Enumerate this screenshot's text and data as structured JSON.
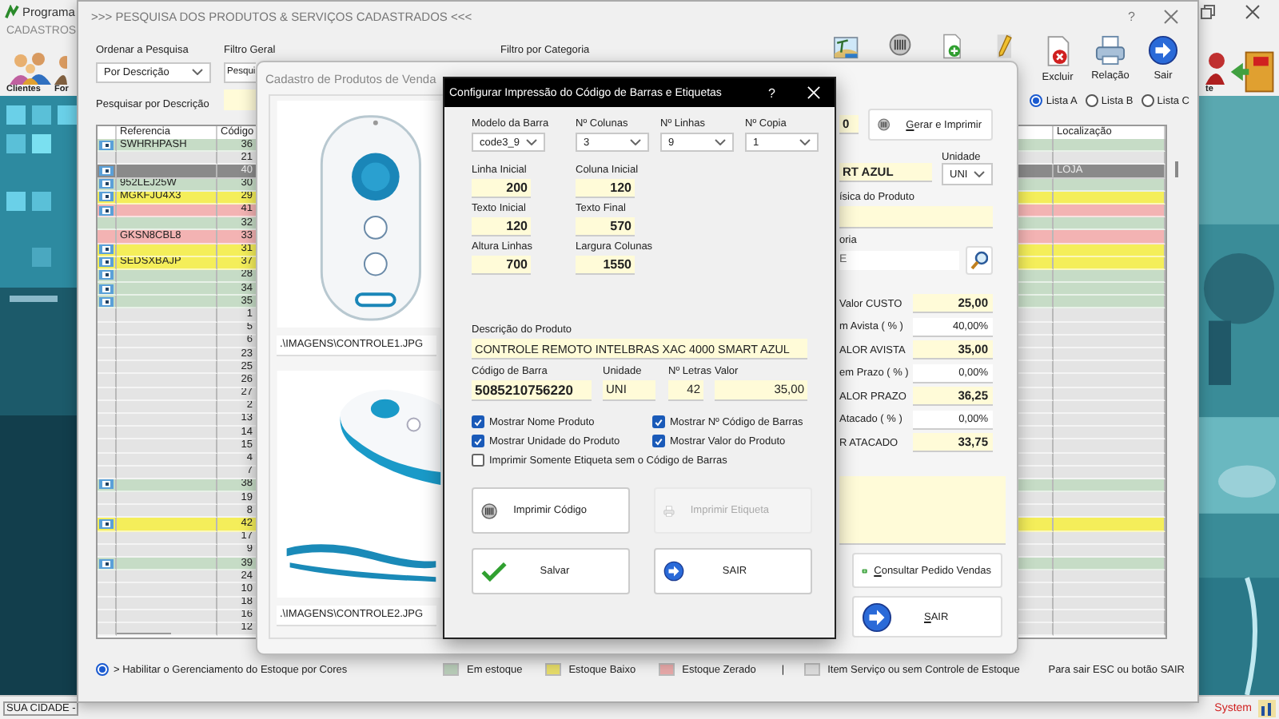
{
  "app": {
    "title": "Programa",
    "menu": [
      "CADASTROS"
    ],
    "toolbar": [
      {
        "kind": "people",
        "label": "Clientes"
      },
      {
        "kind": "person",
        "label": "For"
      }
    ],
    "right_toolbar": [
      {
        "kind": "person",
        "label": "te"
      },
      {
        "kind": "exit"
      }
    ],
    "status_bar": {
      "left": "SUA CIDADE -",
      "right": "System"
    }
  },
  "search_window": {
    "title": ">>> PESQUISA DOS PRODUTOS & SERVIÇOS CADASTRADOS <<<",
    "help": "?",
    "sort": {
      "label": "Ordenar a Pesquisa",
      "value": "Por Descrição"
    },
    "general_filter": {
      "label": "Filtro Geral",
      "value": "Pesqui"
    },
    "category_filter": {
      "label": "Filtro por Categoria"
    },
    "search": {
      "label": "Pesquisar por Descrição"
    },
    "toolbar": [
      {
        "kind": "picture"
      },
      {
        "kind": "barcode"
      },
      {
        "kind": "add"
      },
      {
        "kind": "edit"
      },
      {
        "kind": "delete",
        "label": "Excluir"
      },
      {
        "kind": "report",
        "label": "Relação"
      },
      {
        "kind": "exit",
        "label": "Sair"
      }
    ],
    "lists": [
      {
        "label": "Lista A",
        "selected": true
      },
      {
        "label": "Lista B",
        "selected": false
      },
      {
        "label": "Lista C",
        "selected": false
      }
    ],
    "table": {
      "columns": [
        "Referencia",
        "Código",
        "Localização"
      ],
      "rows": [
        {
          "reference": "SWHRHPASH",
          "code": "36",
          "color": "#c6dcc6",
          "icon": true,
          "selected": false
        },
        {
          "code": "21",
          "color": "#e4e4e4",
          "icon": false,
          "selected": false
        },
        {
          "code": "40",
          "icon": true,
          "selected": true,
          "location": "LOJA"
        },
        {
          "reference": "952LEJ25W",
          "code": "30",
          "color": "#c6dcc6",
          "icon": true,
          "selected": false
        },
        {
          "reference": "MGKFJU4X3",
          "code": "29",
          "color": "#f4ee5a",
          "icon": true,
          "selected": false
        },
        {
          "code": "41",
          "color": "#f3b3b3",
          "icon": true,
          "selected": false
        },
        {
          "code": "32",
          "color": "#c6dcc6",
          "icon": false,
          "selected": false
        },
        {
          "reference": "GKSN8CBL8",
          "code": "33",
          "color": "#f3b3b3",
          "icon": false,
          "selected": false
        },
        {
          "code": "31",
          "color": "#f4ee5a",
          "icon": true,
          "selected": false
        },
        {
          "reference": "SEDSXBAJP",
          "code": "37",
          "color": "#f4ee5a",
          "icon": true,
          "selected": false
        },
        {
          "code": "28",
          "color": "#c6dcc6",
          "icon": true,
          "selected": false
        },
        {
          "code": "34",
          "color": "#c6dcc6",
          "icon": true,
          "selected": false
        },
        {
          "code": "35",
          "color": "#c6dcc6",
          "icon": true,
          "selected": false
        },
        {
          "code": "1",
          "color": "#e4e4e4",
          "icon": false,
          "selected": false
        },
        {
          "code": "5",
          "color": "#e4e4e4",
          "icon": false,
          "selected": false
        },
        {
          "code": "6",
          "color": "#e4e4e4",
          "icon": false,
          "selected": false
        },
        {
          "code": "23",
          "color": "#e4e4e4",
          "icon": false,
          "selected": false
        },
        {
          "code": "25",
          "color": "#e4e4e4",
          "icon": false,
          "selected": false
        },
        {
          "code": "26",
          "color": "#e4e4e4",
          "icon": false,
          "selected": false
        },
        {
          "code": "27",
          "color": "#e4e4e4",
          "icon": false,
          "selected": false
        },
        {
          "code": "2",
          "color": "#e4e4e4",
          "icon": false,
          "selected": false
        },
        {
          "code": "13",
          "color": "#e4e4e4",
          "icon": false,
          "selected": false
        },
        {
          "code": "14",
          "color": "#e4e4e4",
          "icon": false,
          "selected": false
        },
        {
          "code": "15",
          "color": "#e4e4e4",
          "icon": false,
          "selected": false
        },
        {
          "code": "4",
          "color": "#e4e4e4",
          "icon": false,
          "selected": false
        },
        {
          "code": "7",
          "color": "#e4e4e4",
          "icon": false,
          "selected": false
        },
        {
          "code": "38",
          "color": "#c6dcc6",
          "icon": true,
          "selected": false
        },
        {
          "code": "19",
          "color": "#e4e4e4",
          "icon": false,
          "selected": false
        },
        {
          "code": "8",
          "color": "#e4e4e4",
          "icon": false,
          "selected": false
        },
        {
          "code": "42",
          "color": "#f4ee5a",
          "icon": true,
          "selected": false
        },
        {
          "code": "17",
          "color": "#e4e4e4",
          "icon": false,
          "selected": false
        },
        {
          "code": "9",
          "color": "#e4e4e4",
          "icon": false,
          "selected": false
        },
        {
          "code": "39",
          "color": "#c6dcc6",
          "icon": true,
          "selected": false
        },
        {
          "code": "24",
          "color": "#e4e4e4",
          "icon": false,
          "selected": false
        },
        {
          "code": "10",
          "color": "#e4e4e4",
          "icon": false,
          "selected": false
        },
        {
          "code": "18",
          "color": "#e4e4e4",
          "icon": false,
          "selected": false
        },
        {
          "code": "16",
          "color": "#e4e4e4",
          "icon": false,
          "selected": false
        },
        {
          "code": "12",
          "color": "#e4e4e4",
          "icon": false,
          "selected": false
        }
      ]
    },
    "legend": {
      "toggle": {
        "label": "> Habilitar o Gerenciamento do Estoque por Cores",
        "on": true
      },
      "items": [
        {
          "label": "Em estoque",
          "color": "#b8ccb8"
        },
        {
          "label": "Estoque Baixo",
          "color": "#e6dc6a"
        },
        {
          "label": "Estoque Zerado",
          "color": "#e6a8a8"
        },
        {
          "label": "Item Serviço ou sem Controle de Estoque",
          "color": "#dcdcdc"
        }
      ],
      "separator": "|",
      "exit_hint": "Para sair ESC ou botão SAIR"
    }
  },
  "product_window": {
    "title": "Cadastro de Produtos de Venda",
    "images": [
      {
        "path": ".\\IMAGENS\\CONTROLE1.JPG"
      },
      {
        "path": ".\\IMAGENS\\CONTROLE2.JPG"
      }
    ],
    "code_value": "0",
    "generate_button": "Gerar e Imprimir",
    "description_value": "RT AZUL",
    "unit": {
      "label": "Unidade",
      "value": "UNI"
    },
    "physical_label": "ísica do Produto",
    "category_label": "oria",
    "category_value": "E",
    "prices": [
      {
        "label": "Valor CUSTO",
        "value": "25,00",
        "kind": "total"
      },
      {
        "label": "m Avista ( % )",
        "value": "40,00%",
        "kind": "percent"
      },
      {
        "label": "ALOR AVISTA",
        "value": "35,00",
        "kind": "total"
      },
      {
        "label": "em Prazo ( % )",
        "value": "0,00%",
        "kind": "percent"
      },
      {
        "label": "ALOR PRAZO",
        "value": "36,25",
        "kind": "total"
      },
      {
        "label": "Atacado ( % )",
        "value": "0,00%",
        "kind": "percent"
      },
      {
        "label": "R ATACADO",
        "value": "33,75",
        "kind": "total"
      }
    ],
    "buttons": [
      {
        "kind": "orders",
        "label": "Consultar Pedido Vendas"
      },
      {
        "kind": "exit",
        "label": "SAIR"
      }
    ]
  },
  "dialog": {
    "title": "Configurar Impressão do Código de Barras e Etiquetas",
    "help": "?",
    "selects": [
      {
        "label": "Modelo da Barra",
        "value": "code3_9"
      },
      {
        "label": "Nº Colunas",
        "value": "3"
      },
      {
        "label": "Nº Linhas",
        "value": "9"
      },
      {
        "label": "Nº Copia",
        "value": "1"
      }
    ],
    "positions": [
      {
        "label": "Linha Inicial",
        "value": "200"
      },
      {
        "label": "Coluna Inicial",
        "value": "120"
      },
      {
        "label": "Texto Inicial",
        "value": "120"
      },
      {
        "label": "Texto Final",
        "value": "570"
      },
      {
        "label": "Altura Linhas",
        "value": "700"
      },
      {
        "label": "Largura Colunas",
        "value": "1550"
      }
    ],
    "description": {
      "label": "Descrição do Produto",
      "value": "CONTROLE REMOTO INTELBRAS XAC 4000 SMART AZUL"
    },
    "fields": [
      {
        "label": "Código de Barra",
        "value": "5085210756220",
        "kind": "barcode"
      },
      {
        "label": "Unidade",
        "value": "UNI",
        "kind": "text"
      },
      {
        "label": "Nº Letras",
        "value": "42",
        "kind": "number"
      },
      {
        "label": "Valor",
        "value": "35,00",
        "kind": "number"
      }
    ],
    "options": [
      {
        "label": "Mostrar Nome Produto",
        "checked": true
      },
      {
        "label": "Mostrar Nº Código de Barras",
        "checked": true
      },
      {
        "label": "Mostrar Unidade do Produto",
        "checked": true
      },
      {
        "label": "Mostrar Valor do Produto",
        "checked": true
      },
      {
        "label": "Imprimir Somente Etiqueta sem o Código de Barras",
        "checked": false
      }
    ],
    "buttons": [
      {
        "kind": "print_code",
        "label": "Imprimir Código",
        "disabled": false
      },
      {
        "kind": "print_label",
        "label": "Imprimir Etiqueta",
        "disabled": true
      },
      {
        "kind": "save",
        "label": "Salvar",
        "disabled": false
      },
      {
        "kind": "exit",
        "label": "SAIR",
        "disabled": false
      }
    ]
  }
}
